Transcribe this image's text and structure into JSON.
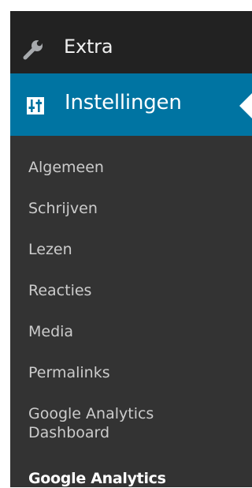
{
  "menu": {
    "extra": {
      "label": "Extra",
      "icon": "wrench-icon"
    },
    "settings": {
      "label": "Instellingen",
      "icon": "settings-sliders-icon"
    },
    "submenu": [
      {
        "label": "Algemeen"
      },
      {
        "label": "Schrijven"
      },
      {
        "label": "Lezen"
      },
      {
        "label": "Reacties"
      },
      {
        "label": "Media"
      },
      {
        "label": "Permalinks"
      },
      {
        "label": "Google Analytics\nDashboard"
      },
      {
        "label": "Google Analytics"
      }
    ]
  },
  "colors": {
    "menu_bg": "#222222",
    "submenu_bg": "#333333",
    "current_bg": "#0074a2",
    "text": "#cccccc",
    "active_text": "#ffffff"
  }
}
